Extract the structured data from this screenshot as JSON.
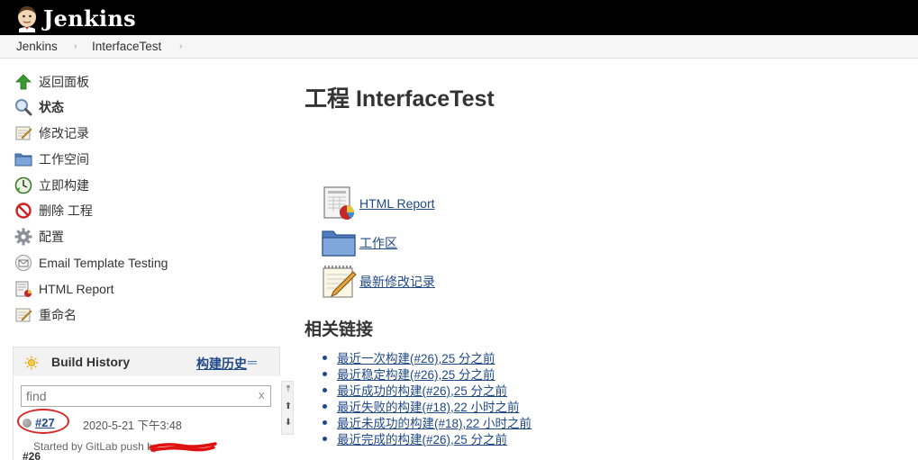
{
  "header": {
    "title": "Jenkins"
  },
  "breadcrumb": {
    "items": [
      "Jenkins",
      "InterfaceTest"
    ]
  },
  "side_panel": {
    "tasks": [
      {
        "label": "返回面板",
        "icon": "up-arrow-icon"
      },
      {
        "label": "状态",
        "icon": "magnifier-icon"
      },
      {
        "label": "修改记录",
        "icon": "notepad-icon"
      },
      {
        "label": "工作空间",
        "icon": "folder-icon"
      },
      {
        "label": "立即构建",
        "icon": "clock-icon"
      },
      {
        "label": "删除 工程",
        "icon": "no-entry-icon"
      },
      {
        "label": "配置",
        "icon": "gear-icon"
      },
      {
        "label": "Email Template Testing",
        "icon": "envelope-icon"
      },
      {
        "label": "HTML Report",
        "icon": "report-icon"
      },
      {
        "label": "重命名",
        "icon": "notepad-icon"
      }
    ]
  },
  "build_history": {
    "title": "Build History",
    "link_label": "构建历史",
    "toggle": "═",
    "search_placeholder": "find",
    "clear_label": "x",
    "builds": [
      {
        "number": "#27",
        "date": "2020-5-21 下午3:48",
        "cause": "Started by GitLab push by"
      }
    ],
    "next_row_label": "#26"
  },
  "main": {
    "title": "工程 InterfaceTest",
    "links": [
      {
        "label": "HTML Report",
        "icon": "report-icon"
      },
      {
        "label": "工作区",
        "icon": "folder-icon"
      },
      {
        "label": "最新修改记录",
        "icon": "notepad-icon"
      }
    ],
    "related_title": "相关链接",
    "related_links": [
      "最近一次构建(#26),25 分之前",
      "最近稳定构建(#26),25 分之前",
      "最近成功的构建(#26),25 分之前",
      "最近失败的构建(#18),22 小时之前",
      "最近未成功的构建(#18),22 小时之前",
      "最近完成的构建(#26),25 分之前"
    ]
  },
  "colors": {
    "header_bg": "#000000",
    "link": "#204a87",
    "highlight_ring": "#d62a2a"
  }
}
